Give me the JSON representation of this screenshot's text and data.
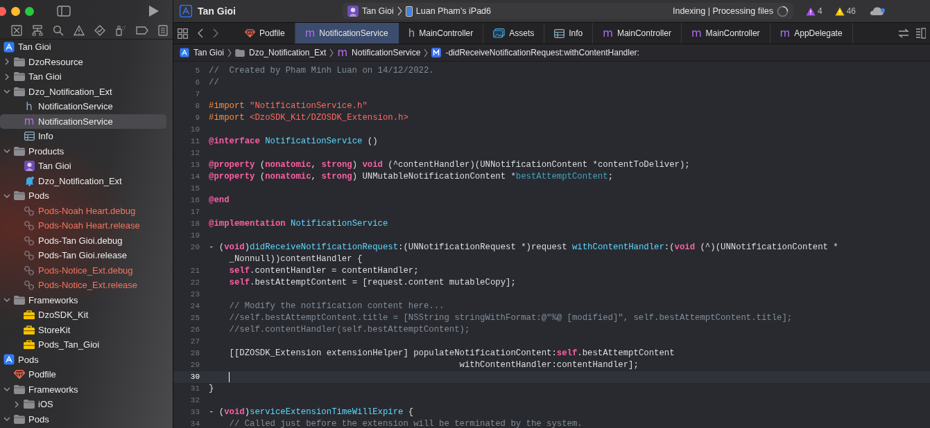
{
  "toolbar": {
    "project_title": "Tan Gioi",
    "scheme": "Tan Gioi",
    "device": "Luan Pham’s iPad6",
    "status": "Indexing | Processing files",
    "issues": [
      {
        "kind": "runtime",
        "count": "4"
      },
      {
        "kind": "warning",
        "count": "46"
      }
    ]
  },
  "sidebar": {
    "items": [
      {
        "label": "Tan Gioi",
        "kind": "project",
        "selected": false,
        "children": [
          {
            "label": "DzoResource",
            "kind": "folder",
            "expanded": false,
            "selected": false
          },
          {
            "label": "Tan Gioi",
            "kind": "folder",
            "expanded": false,
            "selected": false
          },
          {
            "label": "Dzo_Notification_Ext",
            "kind": "folder",
            "expanded": true,
            "selected": false,
            "children": [
              {
                "label": "NotificationService",
                "kind": "h",
                "selected": false
              },
              {
                "label": "NotificationService",
                "kind": "m",
                "selected": true
              },
              {
                "label": "Info",
                "kind": "plist",
                "selected": false
              }
            ]
          },
          {
            "label": "Products",
            "kind": "folder",
            "expanded": true,
            "selected": false,
            "children": [
              {
                "label": "Tan Gioi",
                "kind": "app",
                "selected": false
              },
              {
                "label": "Dzo_Notification_Ext",
                "kind": "bell",
                "selected": false
              }
            ]
          },
          {
            "label": "Pods",
            "kind": "folder",
            "expanded": true,
            "selected": false,
            "children": [
              {
                "label": "Pods-Noah Heart.debug",
                "kind": "config",
                "missing": true,
                "selected": false
              },
              {
                "label": "Pods-Noah Heart.release",
                "kind": "config",
                "missing": true,
                "selected": false
              },
              {
                "label": "Pods-Tan Gioi.debug",
                "kind": "config",
                "missing": false,
                "selected": false
              },
              {
                "label": "Pods-Tan Gioi.release",
                "kind": "config",
                "missing": false,
                "selected": false
              },
              {
                "label": "Pods-Notice_Ext.debug",
                "kind": "config",
                "missing": true,
                "selected": false
              },
              {
                "label": "Pods-Notice_Ext.release",
                "kind": "config",
                "missing": true,
                "selected": false
              }
            ]
          },
          {
            "label": "Frameworks",
            "kind": "folder",
            "expanded": true,
            "selected": false,
            "children": [
              {
                "label": "DzoSDK_Kit",
                "kind": "toolbox",
                "selected": false
              },
              {
                "label": "StoreKit",
                "kind": "toolbox",
                "selected": false
              },
              {
                "label": "Pods_Tan_Gioi",
                "kind": "toolbox",
                "selected": false
              }
            ]
          }
        ]
      },
      {
        "label": "Pods",
        "kind": "project",
        "selected": false,
        "children": [
          {
            "label": "Podfile",
            "kind": "podfile",
            "selected": false
          },
          {
            "label": "Frameworks",
            "kind": "folder",
            "expanded": true,
            "selected": false,
            "children": [
              {
                "label": "iOS",
                "kind": "folder",
                "expanded": false,
                "selected": false
              }
            ]
          },
          {
            "label": "Pods",
            "kind": "folder",
            "expanded": true,
            "selected": false
          }
        ]
      }
    ]
  },
  "tabs": [
    {
      "kind": "podfile",
      "label": "Podfile",
      "selected": false
    },
    {
      "kind": "m",
      "label": "NotificationService",
      "selected": true
    },
    {
      "kind": "h",
      "label": "MainController",
      "selected": false
    },
    {
      "kind": "assets",
      "label": "Assets",
      "selected": false
    },
    {
      "kind": "plist",
      "label": "Info",
      "selected": false
    },
    {
      "kind": "m",
      "label": "MainController",
      "selected": false
    },
    {
      "kind": "m",
      "label": "MainController",
      "selected": false
    },
    {
      "kind": "m",
      "label": "AppDelegate",
      "selected": false
    }
  ],
  "breadcrumbs": [
    {
      "kind": "project",
      "label": "Tan Gioi"
    },
    {
      "kind": "folder",
      "label": "Dzo_Notification_Ext"
    },
    {
      "kind": "m",
      "label": "NotificationService"
    },
    {
      "kind": "method",
      "label": "-didReceiveNotificationRequest:withContentHandler:"
    }
  ],
  "editor": {
    "lines": [
      {
        "number": "5",
        "current": false,
        "tokens": [
          {
            "kind": "comment",
            "text": "//  Created by Pham Minh Luan on 14/12/2022."
          }
        ]
      },
      {
        "number": "6",
        "current": false,
        "tokens": [
          {
            "kind": "comment",
            "text": "//"
          }
        ]
      },
      {
        "number": "7",
        "current": false
      },
      {
        "number": "8",
        "current": false,
        "tokens": [
          {
            "kind": "preproc",
            "text": "#import "
          },
          {
            "kind": "string",
            "text": "\"NotificationService.h\""
          }
        ]
      },
      {
        "number": "9",
        "current": false,
        "tokens": [
          {
            "kind": "preproc",
            "text": "#import "
          },
          {
            "kind": "string",
            "text": "<DzoSDK_Kit/DZOSDK_Extension.h>"
          }
        ]
      },
      {
        "number": "10",
        "current": false
      },
      {
        "number": "11",
        "current": false,
        "tokens": [
          {
            "kind": "keyword",
            "text": "@interface "
          },
          {
            "kind": "decl",
            "text": "NotificationService"
          },
          {
            "kind": "plain",
            "text": " ()"
          }
        ]
      },
      {
        "number": "12",
        "current": false
      },
      {
        "number": "13",
        "current": false,
        "tokens": [
          {
            "kind": "keyword",
            "text": "@property"
          },
          {
            "kind": "plain",
            "text": " ("
          },
          {
            "kind": "keyword",
            "text": "nonatomic"
          },
          {
            "kind": "plain",
            "text": ", "
          },
          {
            "kind": "keyword",
            "text": "strong"
          },
          {
            "kind": "plain",
            "text": ") "
          },
          {
            "kind": "keyword",
            "text": "void"
          },
          {
            "kind": "plain",
            "text": " (^contentHandler)(UNNotificationContent *contentToDeliver);"
          }
        ]
      },
      {
        "number": "14",
        "current": false,
        "tokens": [
          {
            "kind": "keyword",
            "text": "@property"
          },
          {
            "kind": "plain",
            "text": " ("
          },
          {
            "kind": "keyword",
            "text": "nonatomic"
          },
          {
            "kind": "plain",
            "text": ", "
          },
          {
            "kind": "keyword",
            "text": "strong"
          },
          {
            "kind": "plain",
            "text": ") UNMutableNotificationContent *"
          },
          {
            "kind": "ident",
            "text": "bestAttemptContent"
          },
          {
            "kind": "plain",
            "text": ";"
          }
        ]
      },
      {
        "number": "15",
        "current": false
      },
      {
        "number": "16",
        "current": false,
        "tokens": [
          {
            "kind": "keyword",
            "text": "@end"
          }
        ]
      },
      {
        "number": "17",
        "current": false
      },
      {
        "number": "18",
        "current": false,
        "tokens": [
          {
            "kind": "keyword",
            "text": "@implementation "
          },
          {
            "kind": "decl",
            "text": "NotificationService"
          }
        ]
      },
      {
        "number": "19",
        "current": false
      },
      {
        "number": "20",
        "current": false,
        "tokens": [
          {
            "kind": "plain",
            "text": "- ("
          },
          {
            "kind": "keyword",
            "text": "void"
          },
          {
            "kind": "plain",
            "text": ")"
          },
          {
            "kind": "decl",
            "text": "didReceiveNotificationRequest"
          },
          {
            "kind": "plain",
            "text": ":(UNNotificationRequest *)request "
          },
          {
            "kind": "decl",
            "text": "withContentHandler"
          },
          {
            "kind": "plain",
            "text": ":("
          },
          {
            "kind": "keyword",
            "text": "void"
          },
          {
            "kind": "plain",
            "text": " (^)(UNNotificationContent *"
          }
        ]
      },
      {
        "current": false,
        "tokens": [
          {
            "kind": "plain",
            "text": "    _Nonnull))contentHandler {"
          }
        ]
      },
      {
        "number": "21",
        "current": false,
        "tokens": [
          {
            "kind": "keyword",
            "text": "    self"
          },
          {
            "kind": "plain",
            "text": ".contentHandler = contentHandler;"
          }
        ]
      },
      {
        "number": "22",
        "current": false,
        "tokens": [
          {
            "kind": "keyword",
            "text": "    self"
          },
          {
            "kind": "plain",
            "text": ".bestAttemptContent = [request.content mutableCopy];"
          }
        ]
      },
      {
        "number": "23",
        "current": false
      },
      {
        "number": "24",
        "current": false,
        "tokens": [
          {
            "kind": "comment",
            "text": "    // Modify the notification content here..."
          }
        ]
      },
      {
        "number": "25",
        "current": false,
        "tokens": [
          {
            "kind": "comment",
            "text": "    //self.bestAttemptContent.title = [NSString stringWithFormat:@\"%@ [modified]\", self.bestAttemptContent.title];"
          }
        ]
      },
      {
        "number": "26",
        "current": false,
        "tokens": [
          {
            "kind": "comment",
            "text": "    //self.contentHandler(self.bestAttemptContent);"
          }
        ]
      },
      {
        "number": "27",
        "current": false
      },
      {
        "number": "28",
        "current": false,
        "tokens": [
          {
            "kind": "plain",
            "text": "    [[DZOSDK_Extension extensionHelper] populateNotificationContent:"
          },
          {
            "kind": "keyword",
            "text": "self"
          },
          {
            "kind": "plain",
            "text": ".bestAttemptContent"
          }
        ]
      },
      {
        "number": "29",
        "current": false,
        "tokens": [
          {
            "kind": "plain",
            "text": "                                                 withContentHandler:contentHandler];"
          }
        ]
      },
      {
        "number": "30",
        "current": true
      },
      {
        "number": "31",
        "current": false,
        "tokens": [
          {
            "kind": "plain",
            "text": "}"
          }
        ]
      },
      {
        "number": "32",
        "current": false
      },
      {
        "number": "33",
        "current": false,
        "tokens": [
          {
            "kind": "plain",
            "text": "- ("
          },
          {
            "kind": "keyword",
            "text": "void"
          },
          {
            "kind": "plain",
            "text": ")"
          },
          {
            "kind": "decl",
            "text": "serviceExtensionTimeWillExpire"
          },
          {
            "kind": "plain",
            "text": " {"
          }
        ]
      },
      {
        "number": "34",
        "current": false,
        "tokens": [
          {
            "kind": "comment",
            "text": "    // Called just before the extension will be terminated by the system."
          }
        ]
      }
    ]
  }
}
